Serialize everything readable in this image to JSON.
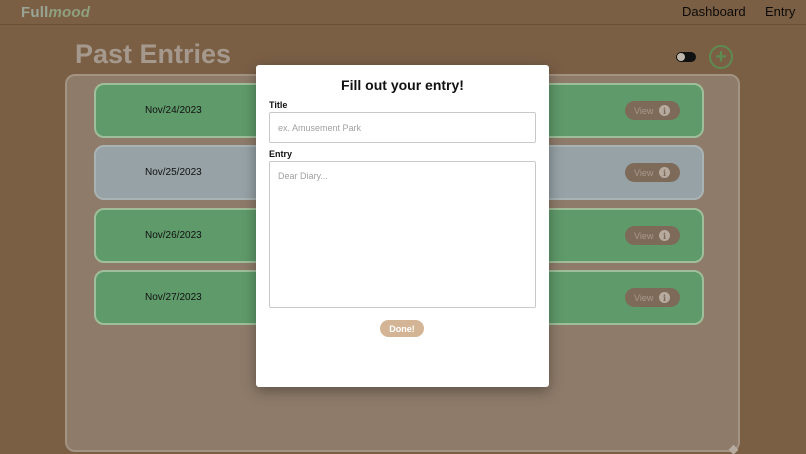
{
  "app": {
    "brand_part1": "Full",
    "brand_part2": "mood"
  },
  "nav": {
    "items": [
      {
        "label": "Dashboard"
      },
      {
        "label": "Entry"
      }
    ]
  },
  "page": {
    "title": "Past Entries",
    "add_icon": "plus-circle-icon"
  },
  "entries": [
    {
      "date": "Nov/24/2023",
      "view_label": "View",
      "status_color": "#5f9a6a"
    },
    {
      "date": "Nov/25/2023",
      "view_label": "View",
      "status_color": "#96a2a6"
    },
    {
      "date": "Nov/26/2023",
      "view_label": "View",
      "status_color": "#5f9a6a"
    },
    {
      "date": "Nov/27/2023",
      "view_label": "View",
      "status_color": "#5f9a6a"
    }
  ],
  "modal": {
    "title": "Fill out your entry!",
    "title_label": "Title",
    "title_placeholder": "ex. Amusement Park",
    "title_value": "",
    "entry_label": "Entry",
    "entry_placeholder": "Dear Diary...",
    "entry_value": "",
    "done_label": "Done!"
  },
  "colors": {
    "background": "#7a5f45",
    "accent_green": "#5f9a6a",
    "done_button": "#d3b596"
  }
}
